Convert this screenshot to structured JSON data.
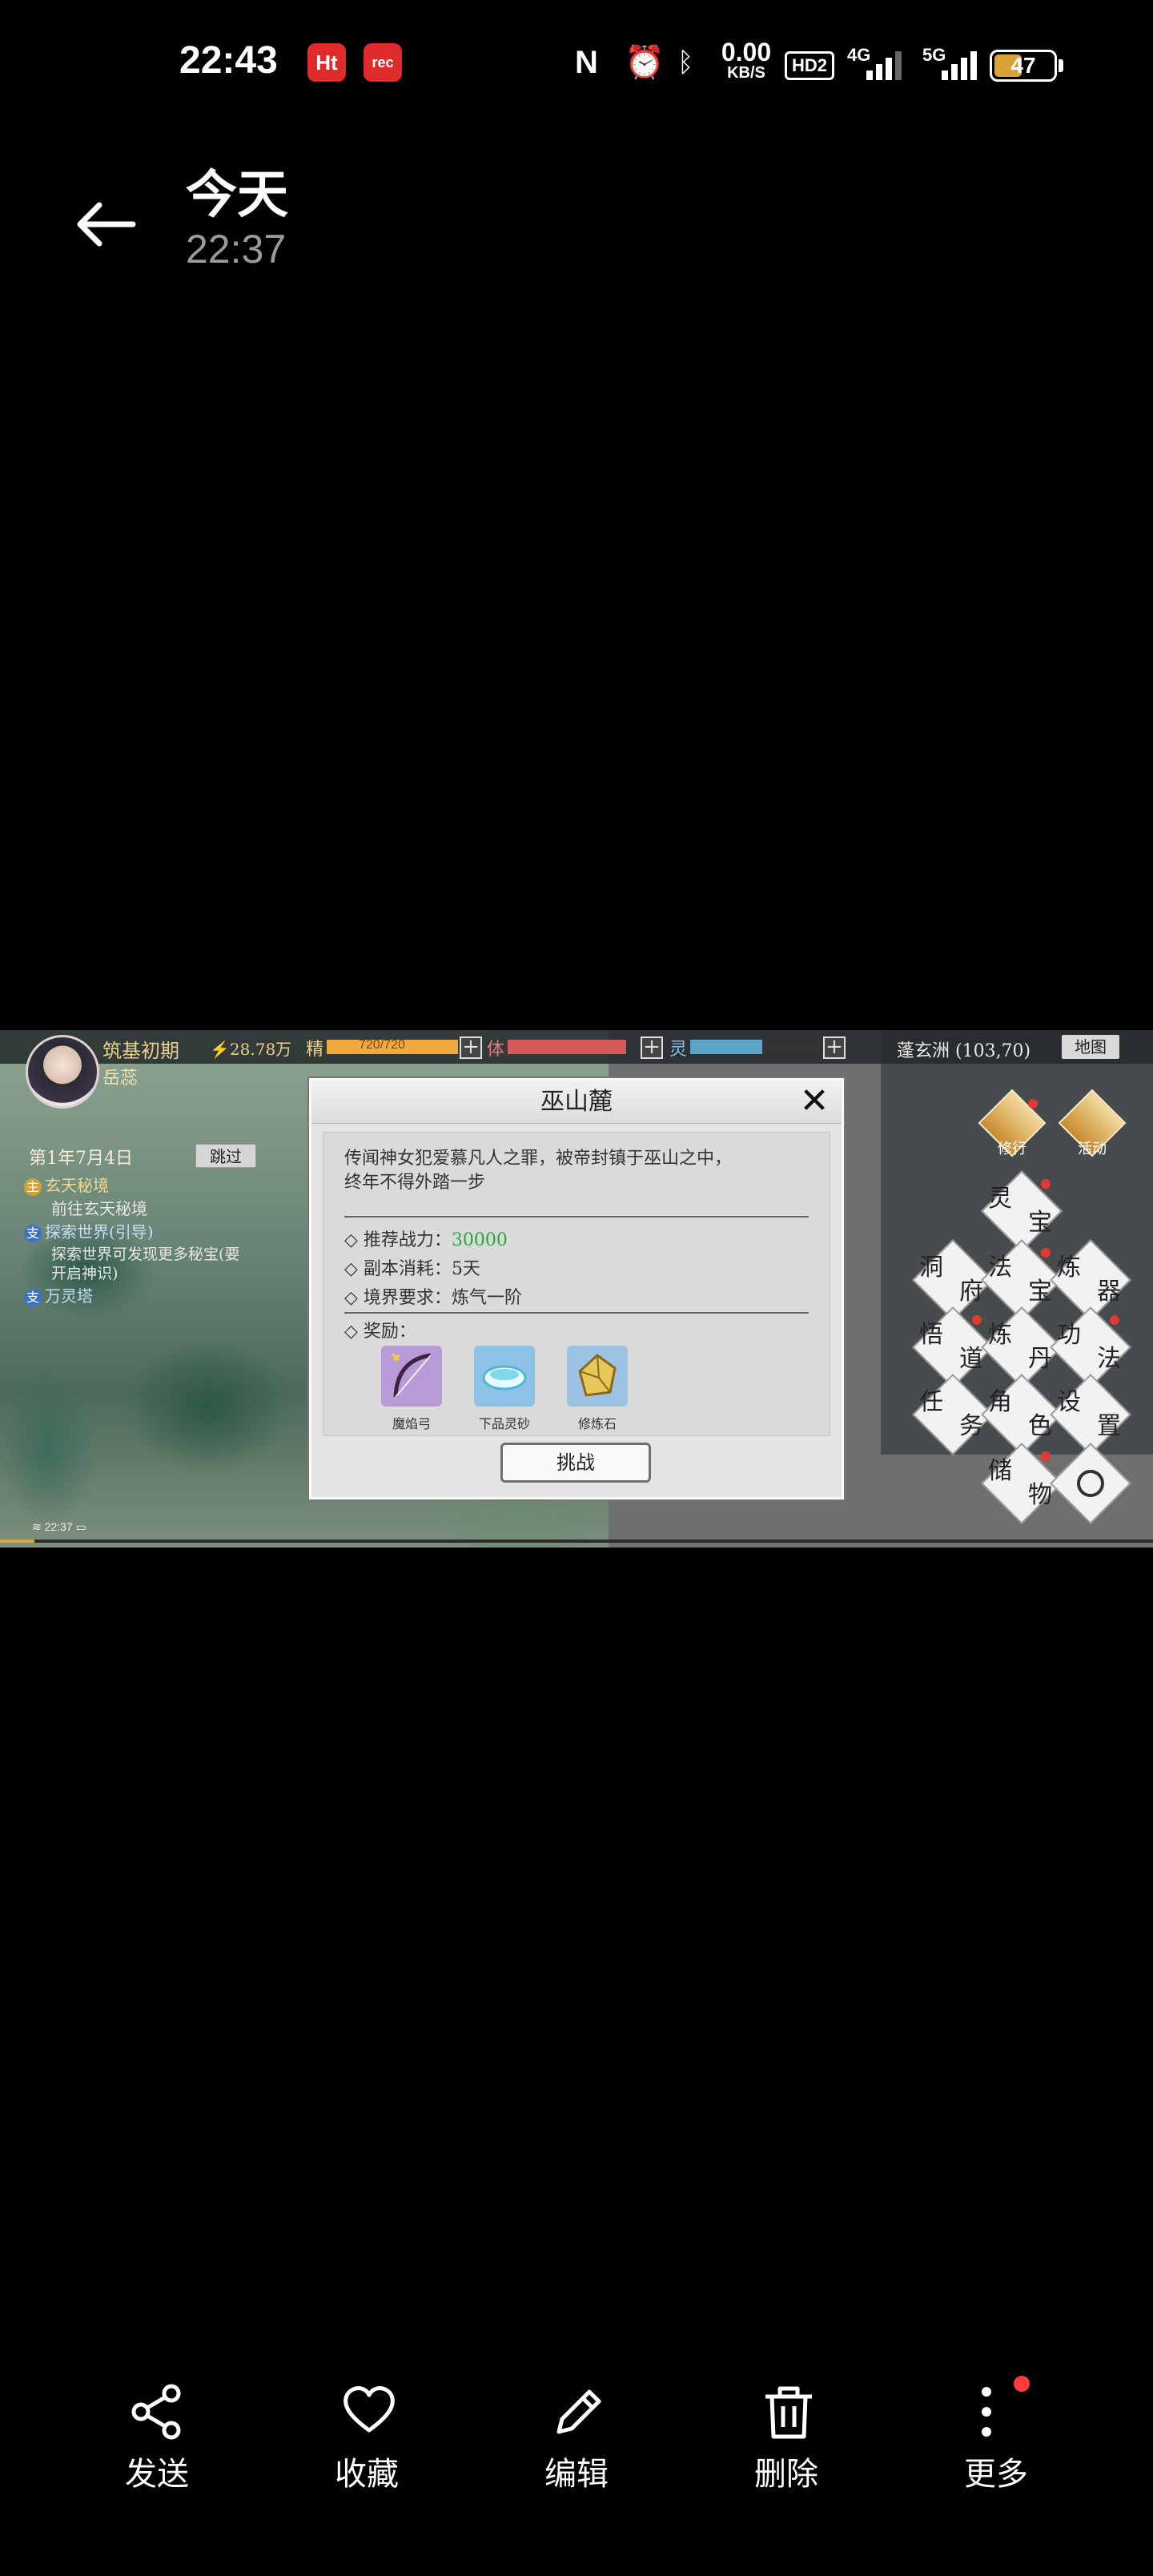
{
  "status_bar": {
    "time": "22:43",
    "app_icon_1": "Ht",
    "app_icon_2": "rec",
    "nfc_icon": "N",
    "net_speed_value": "0.00",
    "net_speed_unit": "KB/S",
    "hd_badge": "HD2",
    "sim1_label": "4G",
    "sim2_label": "5G",
    "battery_level": "47",
    "battery_fraction": 0.47,
    "battery_color": "#d9a33a"
  },
  "header": {
    "title": "今天",
    "subtitle": "22:37",
    "back_icon": "arrow-left-icon"
  },
  "game": {
    "realm": "筑基初期",
    "power": "28.78万",
    "character_name": "岳蕊",
    "jing_label": "精",
    "jing_value": "720/720",
    "jing_fraction": 1.0,
    "jing_color": "#f0a93c",
    "ti_label": "体",
    "ti_fraction": 1.0,
    "ti_color": "#d35a56",
    "ling_label": "灵",
    "ling_fraction": 0.55,
    "ling_color": "#5aa6c8",
    "location": "蓬玄洲 (103,70)",
    "map_button": "地图",
    "date": "第1年7月4日",
    "skip_button": "跳过",
    "quests": [
      {
        "tag": "主",
        "tag_color": "#d0a13a",
        "title": "玄天秘境",
        "detail": "前往玄天秘境"
      },
      {
        "tag": "支",
        "tag_color": "#3a72c8",
        "title": "探索世界(引导)",
        "detail": "探索世界可发现更多秘宝(要开启神识)"
      },
      {
        "tag": "支",
        "tag_color": "#3a72c8",
        "title": "万灵塔",
        "detail": ""
      }
    ],
    "clock_small": "22:37",
    "progress_fraction": 0.03
  },
  "dialog": {
    "title": "巫山麓",
    "close_icon": "close-icon",
    "description_line1": "传闻神女犯爱慕凡人之罪，被帝封镇于巫山之中，",
    "description_line2": "终年不得外踏一步",
    "power_label": "推荐战力：",
    "power_value": "30000",
    "power_value_color": "#2aa63a",
    "cost_label": "副本消耗：",
    "cost_value": "5天",
    "realm_label": "境界要求：",
    "realm_value": "炼气一阶",
    "reward_label": "奖励：",
    "rewards": [
      {
        "name": "魔焰弓",
        "icon": "bow-icon",
        "bg": "#b69bd6"
      },
      {
        "name": "下品灵砂",
        "icon": "sand-icon",
        "bg": "#8ec1e6"
      },
      {
        "name": "修炼石",
        "icon": "stone-icon",
        "bg": "#9cc3e4"
      }
    ],
    "challenge_button": "挑战"
  },
  "menu": {
    "top_buttons": [
      {
        "label": "修行",
        "icon": "cultivate-icon"
      },
      {
        "label": "活动",
        "icon": "activity-icon"
      }
    ],
    "items": [
      {
        "label": "灵宝",
        "dot": true
      },
      {
        "label": "洞府",
        "dot": false
      },
      {
        "label": "法宝",
        "dot": true
      },
      {
        "label": "炼器",
        "dot": false
      },
      {
        "label": "悟道",
        "dot": true
      },
      {
        "label": "炼丹",
        "dot": false
      },
      {
        "label": "功法",
        "dot": true
      },
      {
        "label": "任务",
        "dot": false
      },
      {
        "label": "角色",
        "dot": false
      },
      {
        "label": "设置",
        "dot": false
      },
      {
        "label": "储物",
        "dot": true
      },
      {
        "label": "",
        "dot": false
      }
    ]
  },
  "bottom_actions": [
    {
      "label": "发送",
      "icon": "share-icon"
    },
    {
      "label": "收藏",
      "icon": "heart-icon"
    },
    {
      "label": "编辑",
      "icon": "pencil-icon"
    },
    {
      "label": "删除",
      "icon": "trash-icon"
    },
    {
      "label": "更多",
      "icon": "more-vertical-icon",
      "badge": true
    }
  ]
}
